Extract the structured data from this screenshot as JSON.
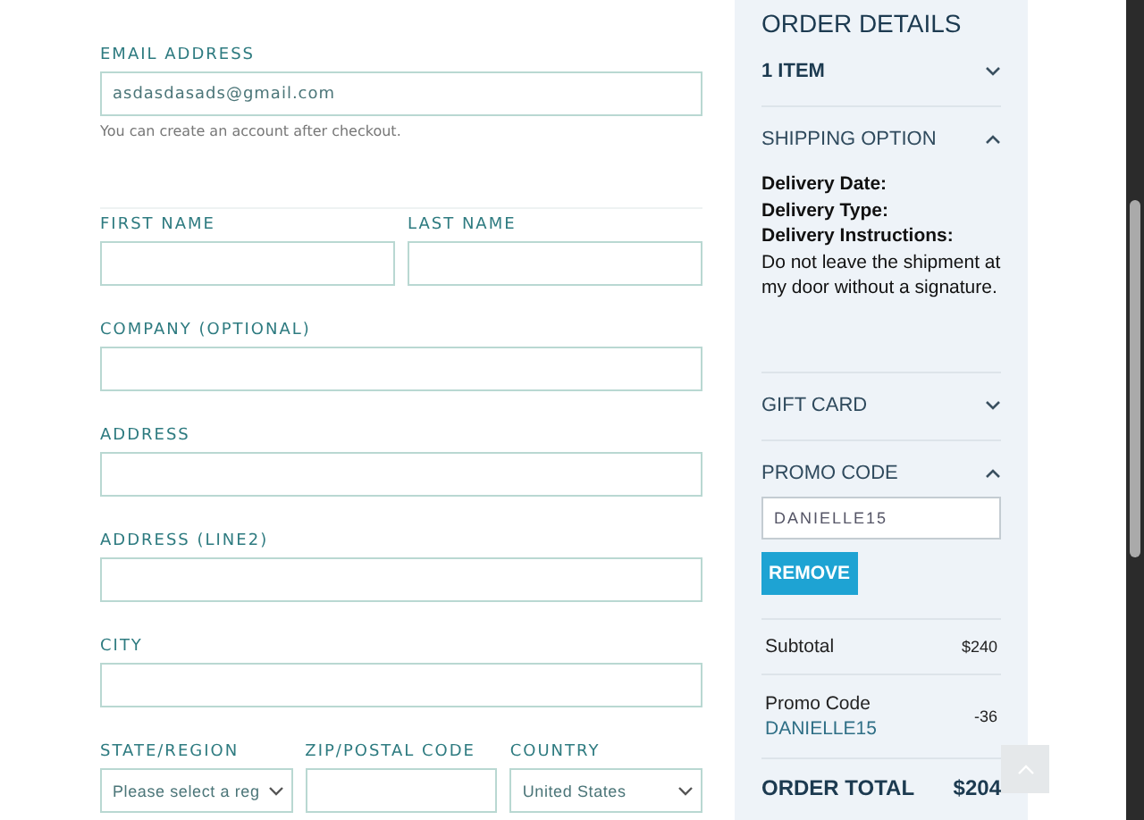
{
  "email": {
    "label": "EMAIL ADDRESS",
    "value": "asdasdasads@gmail.com",
    "hint": "You can create an account after checkout."
  },
  "fields": [
    {
      "kind": "pair",
      "items": [
        {
          "label": "FIRST NAME",
          "kind": "input"
        },
        {
          "label": "LAST NAME",
          "kind": "input"
        }
      ]
    },
    {
      "kind": "single",
      "label": "COMPANY (OPTIONAL)"
    },
    {
      "kind": "single",
      "label": "ADDRESS"
    },
    {
      "kind": "single",
      "label": "ADDRESS (LINE2)"
    },
    {
      "kind": "single",
      "label": "CITY"
    },
    {
      "kind": "triple",
      "items": [
        {
          "label": "STATE/REGION",
          "kind": "select",
          "value": "Please select a reg"
        },
        {
          "label": "ZIP/POSTAL CODE",
          "kind": "input"
        },
        {
          "label": "COUNTRY",
          "kind": "select",
          "value": "United States"
        }
      ]
    }
  ],
  "order": {
    "title": "ORDER DETAILS",
    "sections": [
      {
        "kind": "items",
        "title": "1 ITEM",
        "expanded": false
      },
      {
        "kind": "shipping",
        "title": "SHIPPING OPTION",
        "expanded": true,
        "lines": [
          "Delivery Date:",
          "Delivery Type:",
          "Delivery Instructions:"
        ],
        "note": "Do not leave the shipment at my door without a signature."
      },
      {
        "kind": "gift",
        "title": "GIFT CARD",
        "expanded": false
      },
      {
        "kind": "promo",
        "title": "PROMO CODE",
        "expanded": true,
        "value": "DANIELLE15",
        "button": "REMOVE"
      }
    ],
    "subtotal": {
      "label": "Subtotal",
      "value": "$240"
    },
    "promo": {
      "label": "Promo Code",
      "code": "DANIELLE15",
      "value": "-36"
    },
    "total": {
      "label": "ORDER TOTAL",
      "value": "$204"
    }
  }
}
